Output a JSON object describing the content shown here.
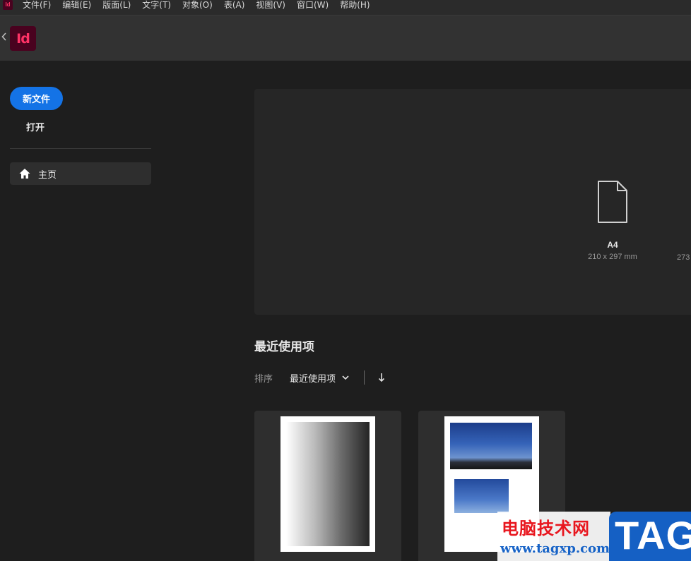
{
  "menubar": {
    "app_icon": "Id",
    "items": [
      "文件(F)",
      "编辑(E)",
      "版面(L)",
      "文字(T)",
      "对象(O)",
      "表(A)",
      "视图(V)",
      "窗口(W)",
      "帮助(H)"
    ]
  },
  "header": {
    "back_icon": "chevron-left-icon",
    "app_logo": "Id"
  },
  "sidebar": {
    "new_file": "新文件",
    "open": "打开",
    "home": "主页",
    "home_icon": "home-icon"
  },
  "presets": {
    "a4_name": "A4",
    "a4_size": "210 x 297 mm",
    "next_partial": "273"
  },
  "recent": {
    "title": "最近使用项",
    "sort_label": "排序",
    "sort_value": "最近使用项",
    "sort_direction_icon": "arrow-down-icon"
  },
  "watermark": {
    "site_name": "电脑技术网",
    "url": "www.tagxp.com",
    "badge": "TAG"
  },
  "colors": {
    "accent": "#1473e6",
    "app_brand": "#ff3366",
    "app_brand_bg": "#49021f"
  }
}
